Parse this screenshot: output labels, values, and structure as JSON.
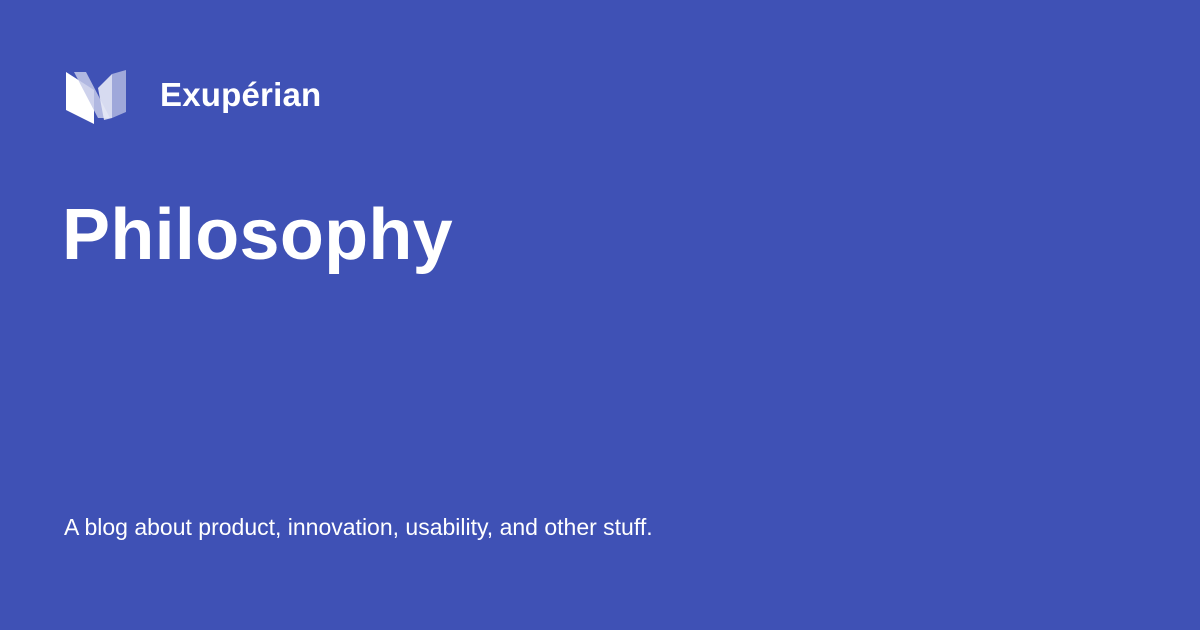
{
  "brand": {
    "logo_icon": "exuperian-logo-icon",
    "name": "Exupérian"
  },
  "page": {
    "title": "Philosophy",
    "tagline": "A blog about product, innovation, usability, and other stuff."
  },
  "colors": {
    "background": "#3f51b5",
    "text": "#ffffff",
    "logo_light": "#ffffff",
    "logo_mid": "#c5cae9",
    "logo_dark": "#9fa8da"
  }
}
